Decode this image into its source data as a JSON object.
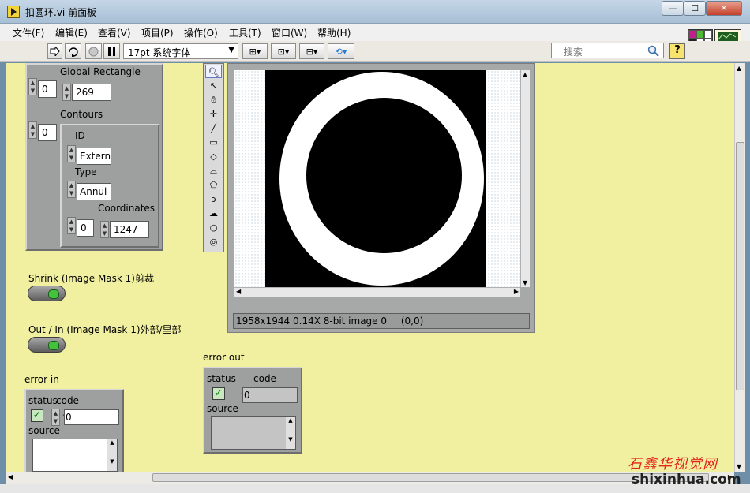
{
  "window": {
    "title": "扣圆环.vi 前面板"
  },
  "window_buttons": {
    "minimize": "—",
    "maximize": "☐",
    "close": "✕"
  },
  "menu": [
    "文件(F)",
    "编辑(E)",
    "查看(V)",
    "项目(P)",
    "操作(O)",
    "工具(T)",
    "窗口(W)",
    "帮助(H)"
  ],
  "toolbar": {
    "font": "17pt 系统字体",
    "search_placeholder": "搜索",
    "help": "?",
    "vi_icon_number": "2"
  },
  "global_rectangle": {
    "label": "Global Rectangle",
    "index": "0",
    "value": "269"
  },
  "contours": {
    "label": "Contours",
    "index": "0",
    "id_label": "ID",
    "id_value": "Extern",
    "type_label": "Type",
    "type_value": "Annul",
    "coordinates_label": "Coordinates",
    "coord_index": "0",
    "coord_value": "1247"
  },
  "shrink": {
    "label": "Shrink (Image Mask 1)剪裁"
  },
  "out_in": {
    "label": "Out / In (Image Mask 1)外部/里部"
  },
  "image_display": {
    "info": "1958x1944 0.14X 8-bit image 0",
    "coords": "(0,0)"
  },
  "error_out": {
    "label": "error out",
    "status": "status",
    "code": "code",
    "code_value": "0",
    "source": "source"
  },
  "error_in": {
    "label": "error in",
    "status": "status",
    "code": "code",
    "code_value": "0",
    "source": "source"
  },
  "watermark": {
    "cn": "石鑫华视觉网",
    "url": "shixinhua.com"
  },
  "colors": {
    "panel": "#f0f0a0",
    "cluster": "#9ea0a0",
    "led_on": "#44c23d"
  }
}
